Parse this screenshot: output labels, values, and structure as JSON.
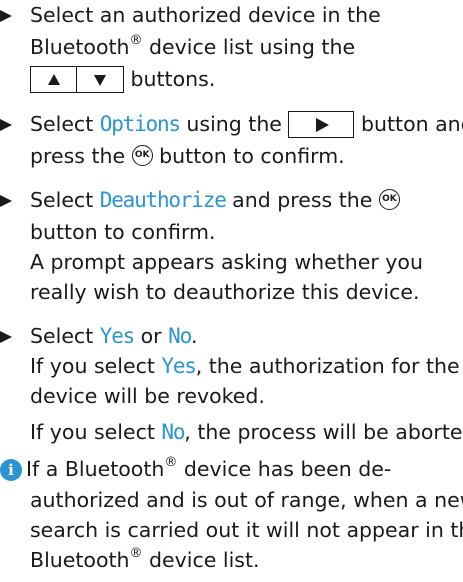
{
  "colors": {
    "text": "#1a1a1a",
    "accent": "#2a95d2"
  },
  "step1": {
    "line1": "Select an authorized device in the",
    "line2_text": "Bluetooth",
    "line2_reg": "®",
    "line2_rest": " device list using the",
    "line3_keys": [
      "arrow-up-icon",
      "arrow-down-icon"
    ],
    "line3_rest": " buttons."
  },
  "step2": {
    "line1_pre": "Select ",
    "line1_kw": "Options",
    "line1_mid": " using the",
    "line1_key": "arrow-right-icon",
    "line1_post": " button and",
    "line2_pre": "press the",
    "line2_ok": "OK",
    "line2_post": " button to confirm."
  },
  "step3": {
    "line1_pre": "Select ",
    "line1_kw": "Deauthorize",
    "line1_post": " and press the",
    "line1_ok": "OK",
    "line2": "button to confirm.",
    "line3": "A prompt appears asking whether you",
    "line4": "really wish to deauthorize this device."
  },
  "step4": {
    "line1_pre": "Select ",
    "line1_kw1": "Yes",
    "line1_mid": " or ",
    "line1_kw2": "No",
    "line1_post": ".",
    "line2_pre": "If you select ",
    "line2_kw": "Yes",
    "line2_post": ", the authorization for the",
    "line3": "device will be revoked.",
    "line4_pre": "If you select ",
    "line4_kw": "No",
    "line4_post": ", the process will be aborted."
  },
  "note": {
    "icon": "info-icon",
    "icon_glyph": "i",
    "line1_pre": " If a Bluetooth",
    "line1_reg": "®",
    "line1_post": " device has been de-",
    "line2": "authorized and is out of range, when a new",
    "line3": "search is carried out it will not appear in the",
    "line4_pre": "Bluetooth",
    "line4_reg": "®",
    "line4_post": " device list."
  }
}
